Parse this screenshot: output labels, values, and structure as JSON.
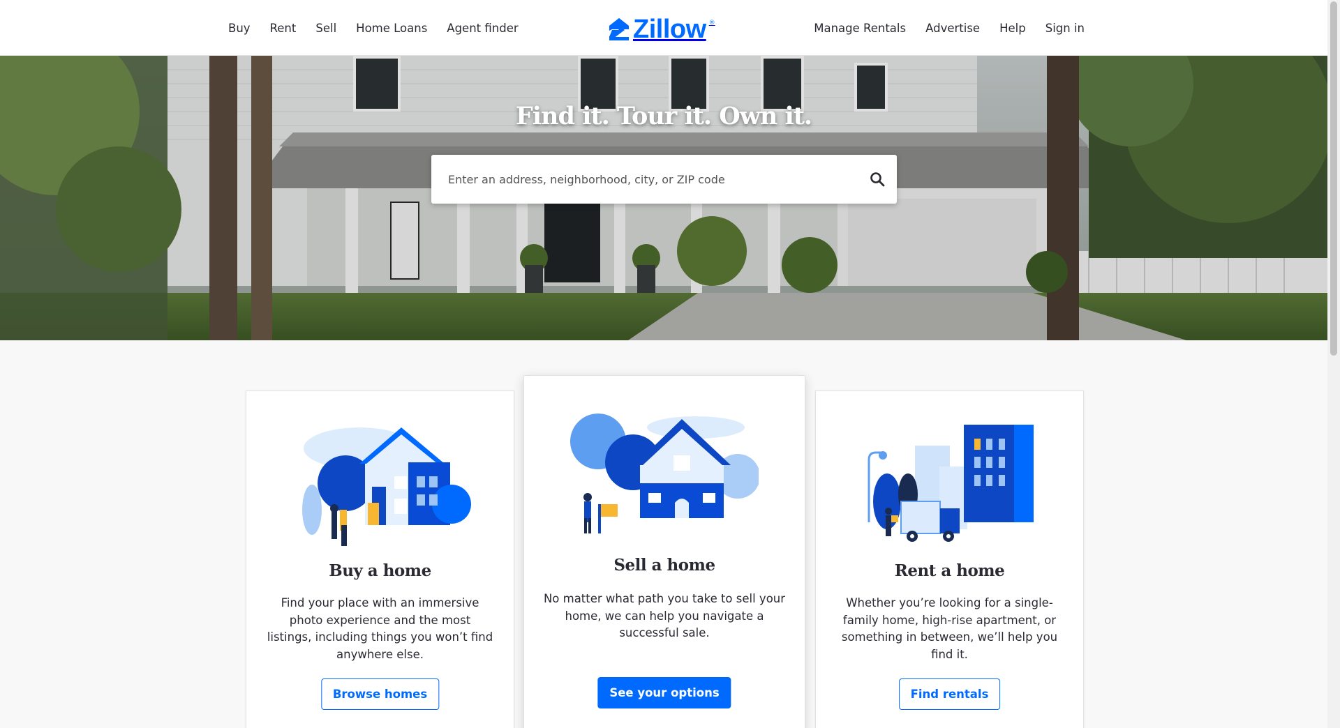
{
  "header": {
    "nav_left": [
      "Buy",
      "Rent",
      "Sell",
      "Home Loans",
      "Agent finder"
    ],
    "nav_right": [
      "Manage Rentals",
      "Advertise",
      "Help",
      "Sign in"
    ],
    "logo_text": "Zillow",
    "logo_mark": "®",
    "brand_color": "#006aff"
  },
  "hero": {
    "title": "Find it. Tour it. Own it.",
    "search_placeholder": "Enter an address, neighborhood, city, or ZIP code",
    "search_icon": "search-icon"
  },
  "cards": [
    {
      "title": "Buy a home",
      "description": "Find your place with an immersive photo experience and the most listings, including things you won’t find anywhere else.",
      "button": "Browse homes",
      "illustration": "buy-home-illustration"
    },
    {
      "title": "Sell a home",
      "description": "No matter what path you take to sell your home, we can help you navigate a successful sale.",
      "button": "See your options",
      "illustration": "sell-home-illustration"
    },
    {
      "title": "Rent a home",
      "description": "Whether you’re looking for a single-family home, high-rise apartment, or something in between, we’ll help you find it.",
      "button": "Find rentals",
      "illustration": "rent-home-illustration"
    }
  ]
}
